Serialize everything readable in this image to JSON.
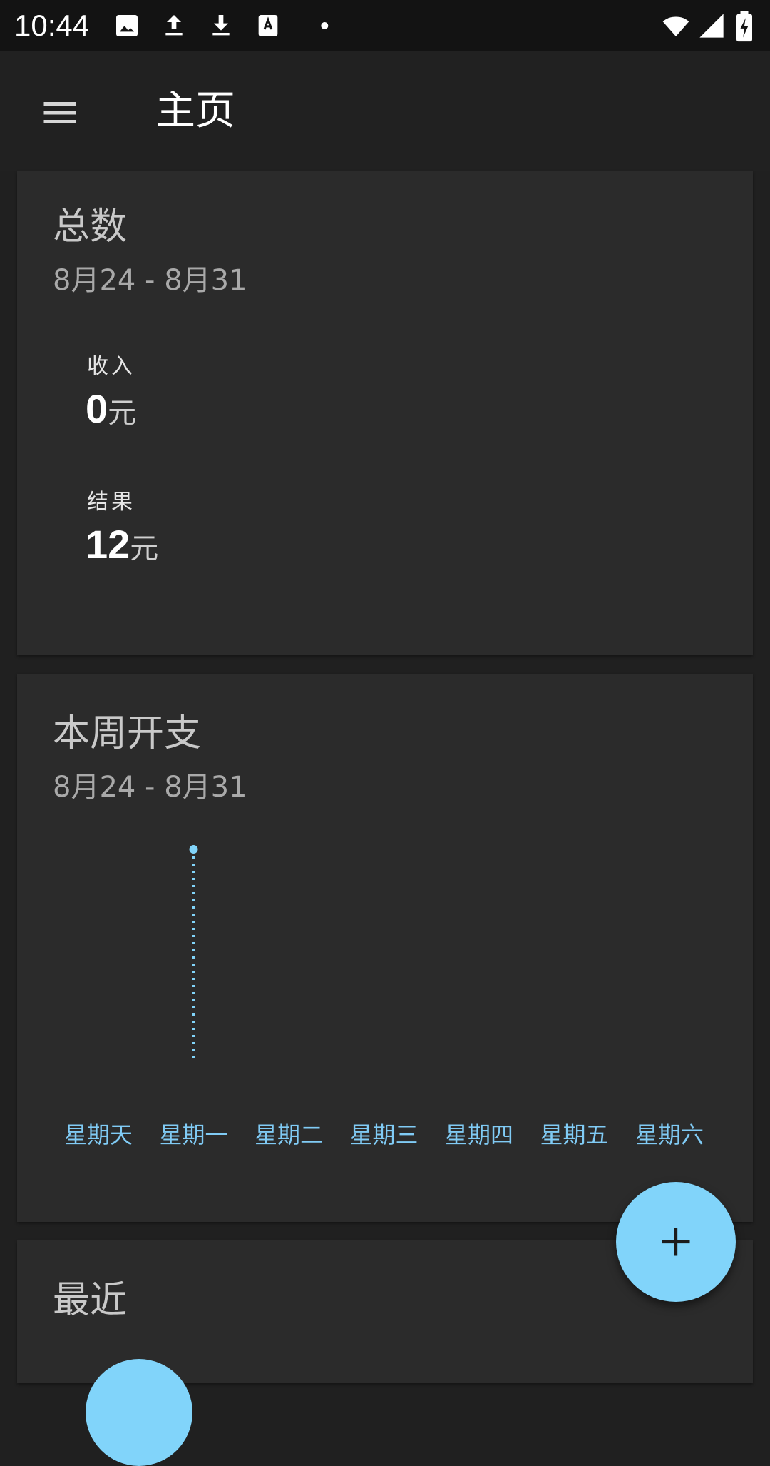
{
  "status_bar": {
    "time": "10:44",
    "left_icons": [
      "image-icon",
      "upload-icon",
      "download-icon",
      "text-recognition-icon",
      "dot-icon"
    ],
    "right_icons": [
      "wifi-icon",
      "signal-icon",
      "battery-charging-icon"
    ]
  },
  "app_bar": {
    "menu_icon": "menu-icon",
    "title": "主页"
  },
  "total_card": {
    "title": "总数",
    "range": "8月24 - 8月31",
    "income": {
      "label": "收入",
      "value": "0",
      "unit": "元"
    },
    "result": {
      "label": "结果",
      "value": "12",
      "unit": "元"
    }
  },
  "week_card": {
    "title": "本周开支",
    "range": "8月24 - 8月31",
    "days": [
      "星期天",
      "星期一",
      "星期二",
      "星期三",
      "星期四",
      "星期五",
      "星期六"
    ]
  },
  "recent_card": {
    "title": "最近"
  },
  "fab": {
    "icon": "plus-icon"
  },
  "colors": {
    "accent": "#81d4fa",
    "card_bg": "#2b2b2b",
    "app_bar_bg": "#212121",
    "status_bar_bg": "#131313",
    "chart_line": "#81d4fa"
  },
  "chart_data": {
    "type": "line",
    "categories": [
      "星期天",
      "星期一",
      "星期二",
      "星期三",
      "星期四",
      "星期五",
      "星期六"
    ],
    "series": [
      {
        "values": [
          null,
          12,
          null,
          null,
          null,
          null,
          null
        ]
      }
    ],
    "ylim": [
      0,
      12
    ],
    "grid": false,
    "title": "本周开支"
  }
}
